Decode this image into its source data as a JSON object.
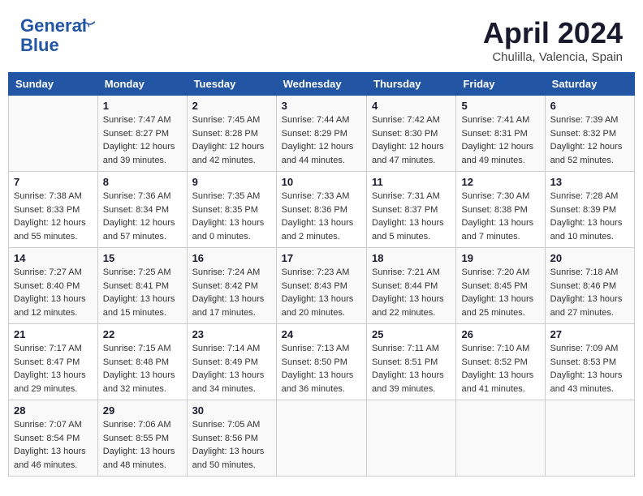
{
  "logo": {
    "line1": "General",
    "line2": "Blue"
  },
  "title": "April 2024",
  "location": "Chulilla, Valencia, Spain",
  "days_header": [
    "Sunday",
    "Monday",
    "Tuesday",
    "Wednesday",
    "Thursday",
    "Friday",
    "Saturday"
  ],
  "weeks": [
    [
      {
        "day": "",
        "content": ""
      },
      {
        "day": "1",
        "content": "Sunrise: 7:47 AM\nSunset: 8:27 PM\nDaylight: 12 hours\nand 39 minutes."
      },
      {
        "day": "2",
        "content": "Sunrise: 7:45 AM\nSunset: 8:28 PM\nDaylight: 12 hours\nand 42 minutes."
      },
      {
        "day": "3",
        "content": "Sunrise: 7:44 AM\nSunset: 8:29 PM\nDaylight: 12 hours\nand 44 minutes."
      },
      {
        "day": "4",
        "content": "Sunrise: 7:42 AM\nSunset: 8:30 PM\nDaylight: 12 hours\nand 47 minutes."
      },
      {
        "day": "5",
        "content": "Sunrise: 7:41 AM\nSunset: 8:31 PM\nDaylight: 12 hours\nand 49 minutes."
      },
      {
        "day": "6",
        "content": "Sunrise: 7:39 AM\nSunset: 8:32 PM\nDaylight: 12 hours\nand 52 minutes."
      }
    ],
    [
      {
        "day": "7",
        "content": "Sunrise: 7:38 AM\nSunset: 8:33 PM\nDaylight: 12 hours\nand 55 minutes."
      },
      {
        "day": "8",
        "content": "Sunrise: 7:36 AM\nSunset: 8:34 PM\nDaylight: 12 hours\nand 57 minutes."
      },
      {
        "day": "9",
        "content": "Sunrise: 7:35 AM\nSunset: 8:35 PM\nDaylight: 13 hours\nand 0 minutes."
      },
      {
        "day": "10",
        "content": "Sunrise: 7:33 AM\nSunset: 8:36 PM\nDaylight: 13 hours\nand 2 minutes."
      },
      {
        "day": "11",
        "content": "Sunrise: 7:31 AM\nSunset: 8:37 PM\nDaylight: 13 hours\nand 5 minutes."
      },
      {
        "day": "12",
        "content": "Sunrise: 7:30 AM\nSunset: 8:38 PM\nDaylight: 13 hours\nand 7 minutes."
      },
      {
        "day": "13",
        "content": "Sunrise: 7:28 AM\nSunset: 8:39 PM\nDaylight: 13 hours\nand 10 minutes."
      }
    ],
    [
      {
        "day": "14",
        "content": "Sunrise: 7:27 AM\nSunset: 8:40 PM\nDaylight: 13 hours\nand 12 minutes."
      },
      {
        "day": "15",
        "content": "Sunrise: 7:25 AM\nSunset: 8:41 PM\nDaylight: 13 hours\nand 15 minutes."
      },
      {
        "day": "16",
        "content": "Sunrise: 7:24 AM\nSunset: 8:42 PM\nDaylight: 13 hours\nand 17 minutes."
      },
      {
        "day": "17",
        "content": "Sunrise: 7:23 AM\nSunset: 8:43 PM\nDaylight: 13 hours\nand 20 minutes."
      },
      {
        "day": "18",
        "content": "Sunrise: 7:21 AM\nSunset: 8:44 PM\nDaylight: 13 hours\nand 22 minutes."
      },
      {
        "day": "19",
        "content": "Sunrise: 7:20 AM\nSunset: 8:45 PM\nDaylight: 13 hours\nand 25 minutes."
      },
      {
        "day": "20",
        "content": "Sunrise: 7:18 AM\nSunset: 8:46 PM\nDaylight: 13 hours\nand 27 minutes."
      }
    ],
    [
      {
        "day": "21",
        "content": "Sunrise: 7:17 AM\nSunset: 8:47 PM\nDaylight: 13 hours\nand 29 minutes."
      },
      {
        "day": "22",
        "content": "Sunrise: 7:15 AM\nSunset: 8:48 PM\nDaylight: 13 hours\nand 32 minutes."
      },
      {
        "day": "23",
        "content": "Sunrise: 7:14 AM\nSunset: 8:49 PM\nDaylight: 13 hours\nand 34 minutes."
      },
      {
        "day": "24",
        "content": "Sunrise: 7:13 AM\nSunset: 8:50 PM\nDaylight: 13 hours\nand 36 minutes."
      },
      {
        "day": "25",
        "content": "Sunrise: 7:11 AM\nSunset: 8:51 PM\nDaylight: 13 hours\nand 39 minutes."
      },
      {
        "day": "26",
        "content": "Sunrise: 7:10 AM\nSunset: 8:52 PM\nDaylight: 13 hours\nand 41 minutes."
      },
      {
        "day": "27",
        "content": "Sunrise: 7:09 AM\nSunset: 8:53 PM\nDaylight: 13 hours\nand 43 minutes."
      }
    ],
    [
      {
        "day": "28",
        "content": "Sunrise: 7:07 AM\nSunset: 8:54 PM\nDaylight: 13 hours\nand 46 minutes."
      },
      {
        "day": "29",
        "content": "Sunrise: 7:06 AM\nSunset: 8:55 PM\nDaylight: 13 hours\nand 48 minutes."
      },
      {
        "day": "30",
        "content": "Sunrise: 7:05 AM\nSunset: 8:56 PM\nDaylight: 13 hours\nand 50 minutes."
      },
      {
        "day": "",
        "content": ""
      },
      {
        "day": "",
        "content": ""
      },
      {
        "day": "",
        "content": ""
      },
      {
        "day": "",
        "content": ""
      }
    ]
  ]
}
